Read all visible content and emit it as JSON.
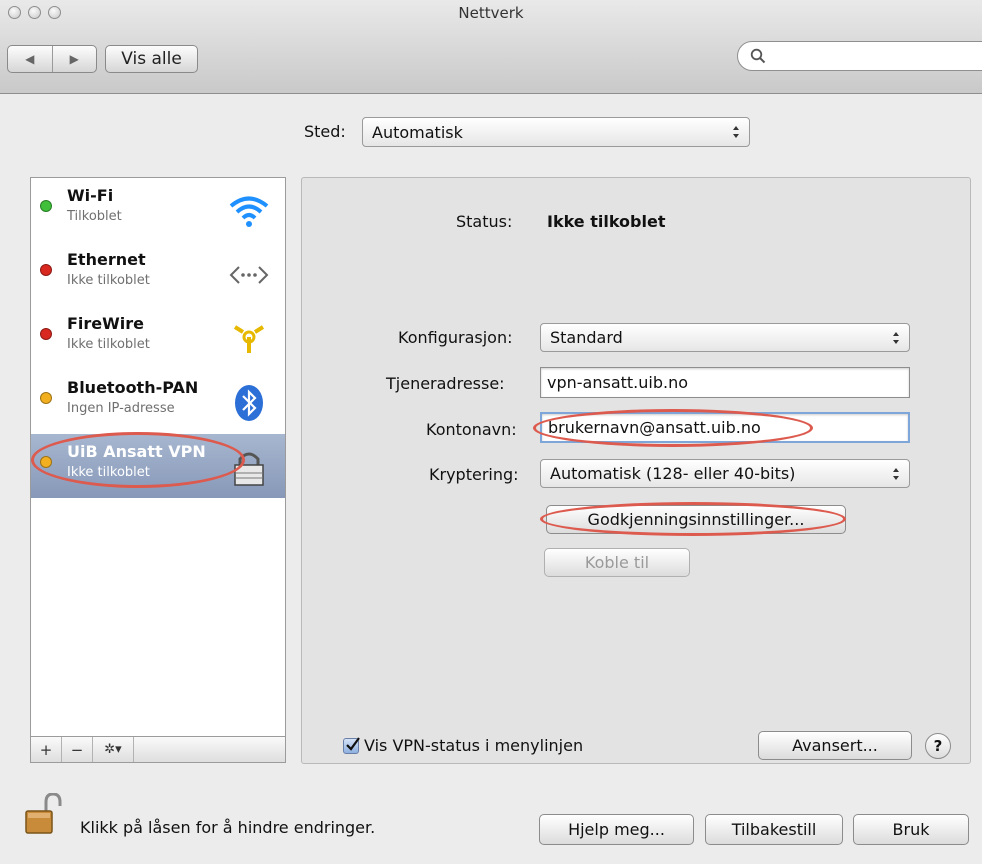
{
  "window": {
    "title": "Nettverk"
  },
  "toolbar": {
    "back_icon": "◀",
    "forward_icon": "▶",
    "show_all_label": "Vis alle",
    "search_placeholder": ""
  },
  "location": {
    "label": "Sted:",
    "value": "Automatisk"
  },
  "services": [
    {
      "name": "Wi-Fi",
      "status": "Tilkoblet",
      "dot_color": "#3fbf3a",
      "icon": "wifi-icon"
    },
    {
      "name": "Ethernet",
      "status": "Ikke tilkoblet",
      "dot_color": "#d8281f",
      "icon": "ethernet-icon"
    },
    {
      "name": "FireWire",
      "status": "Ikke tilkoblet",
      "dot_color": "#d8281f",
      "icon": "firewire-icon"
    },
    {
      "name": "Bluetooth-PAN",
      "status": "Ingen IP-adresse",
      "dot_color": "#f2b020",
      "icon": "bluetooth-icon"
    },
    {
      "name": "UiB Ansatt VPN",
      "status": "Ikke tilkoblet",
      "dot_color": "#f2b020",
      "icon": "vpn-lock-icon",
      "selected": true
    }
  ],
  "sidebar_buttons": {
    "add": "+",
    "remove": "−",
    "gear": "✲▾"
  },
  "detail": {
    "status_label": "Status:",
    "status_value": "Ikke tilkoblet",
    "config_label": "Konfigurasjon:",
    "config_value": "Standard",
    "server_label": "Tjeneradresse:",
    "server_value": "vpn-ansatt.uib.no",
    "account_label": "Kontonavn:",
    "account_value": "brukernavn@ansatt.uib.no",
    "encryption_label": "Kryptering:",
    "encryption_value": "Automatisk (128- eller 40-bits)",
    "auth_button": "Godkjenningsinnstillinger...",
    "connect_button": "Koble til",
    "show_vpn_status_label": "Vis VPN-status i menylinjen",
    "show_vpn_status_checked": true,
    "advanced_button": "Avansert...",
    "help_button": "?"
  },
  "footer": {
    "lock_text": "Klikk på låsen for å hindre endringer.",
    "assist_button": "Hjelp meg...",
    "revert_button": "Tilbakestill",
    "apply_button": "Bruk"
  },
  "colors": {
    "annotation": "#dd5a4e",
    "selection": "#8e9fbc"
  }
}
